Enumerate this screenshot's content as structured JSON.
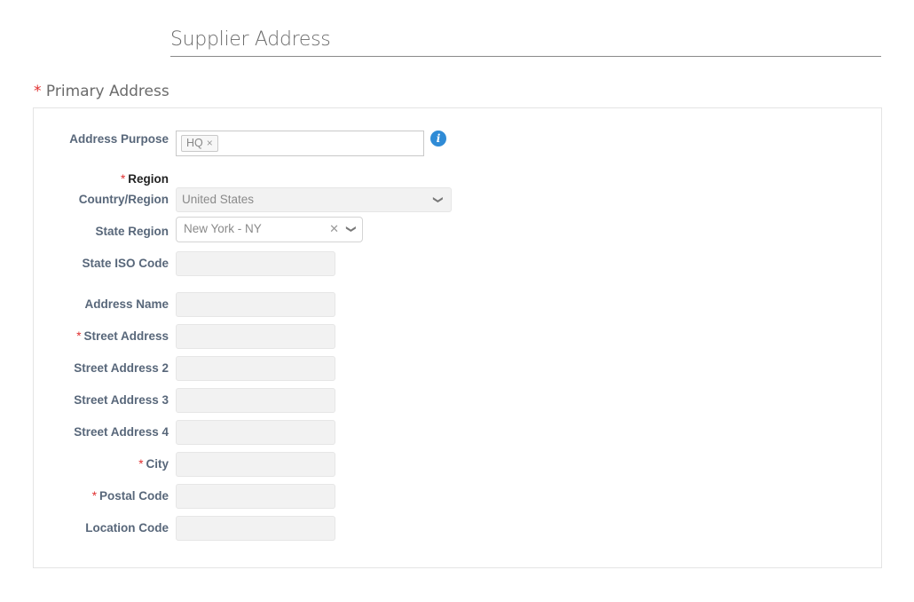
{
  "section": {
    "title": "Supplier Address"
  },
  "group": {
    "title": "Primary Address",
    "required_mark": "*"
  },
  "address_purpose": {
    "label": "Address Purpose",
    "chips": [
      {
        "label": "HQ",
        "remove_icon": "×"
      }
    ],
    "info_icon": "i"
  },
  "region": {
    "label": "Region",
    "required_mark": "*",
    "country": {
      "label": "Country/Region",
      "value": "United States",
      "chevron": "❯"
    },
    "state": {
      "label": "State Region",
      "value": "New York - NY",
      "clear_icon": "✕",
      "chevron": "❯"
    },
    "iso": {
      "label": "State ISO Code",
      "value": ""
    }
  },
  "fields": [
    {
      "label": "Address Name",
      "required": false,
      "value": ""
    },
    {
      "label": "Street Address",
      "required": true,
      "value": ""
    },
    {
      "label": "Street Address 2",
      "required": false,
      "value": ""
    },
    {
      "label": "Street Address 3",
      "required": false,
      "value": ""
    },
    {
      "label": "Street Address 4",
      "required": false,
      "value": ""
    },
    {
      "label": "City",
      "required": true,
      "value": ""
    },
    {
      "label": "Postal Code",
      "required": true,
      "value": ""
    },
    {
      "label": "Location Code",
      "required": false,
      "value": ""
    }
  ],
  "colors": {
    "required": "#e02f2f",
    "label": "#58677a",
    "info": "#2f8bd6"
  }
}
